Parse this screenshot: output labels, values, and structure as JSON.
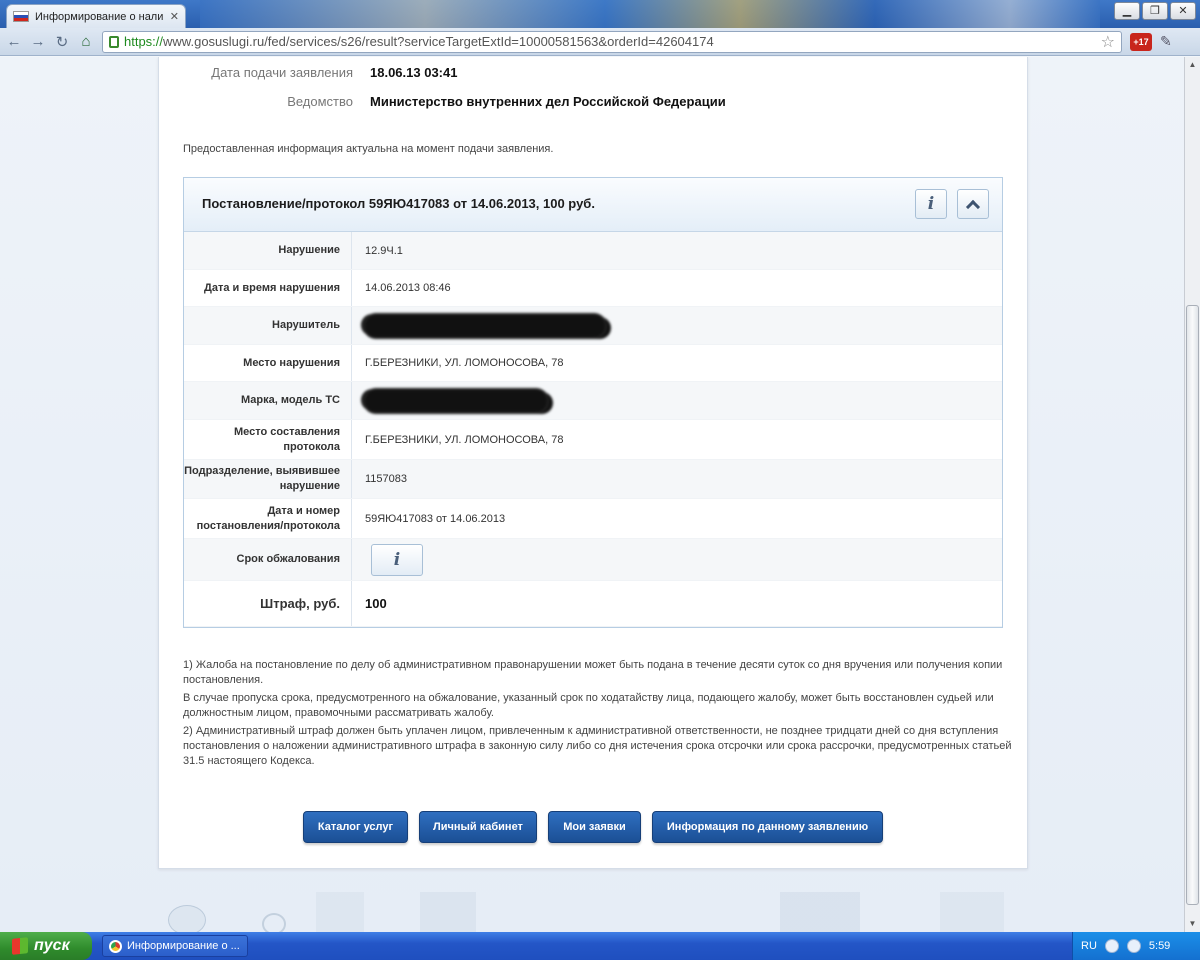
{
  "browser": {
    "tab_title": "Информирование о наличии",
    "tab_close": "✕",
    "url_scheme": "https://",
    "url_rest": "www.gosuslugi.ru/fed/services/s26/result?serviceTargetExtId=10000581563&orderId=42604174",
    "extension_badge": "+17",
    "window_buttons": [
      "▁",
      "❐",
      "✕"
    ]
  },
  "meta": {
    "submission_date_label": "Дата подачи заявления",
    "submission_date_value": "18.06.13 03:41",
    "department_label": "Ведомство",
    "department_value": "Министерство внутренних дел Российской Федерации"
  },
  "notice": "Предоставленная информация актуальна на момент подачи заявления.",
  "panel": {
    "title": "Постановление/протокол 59ЯЮ417083 от 14.06.2013, 100 руб.",
    "rows": {
      "violation_label": "Нарушение",
      "violation_value": "12.9Ч.1",
      "datetime_label": "Дата и время нарушения",
      "datetime_value": "14.06.2013 08:46",
      "offender_label": "Нарушитель",
      "place_label": "Место нарушения",
      "place_value": "Г.БЕРЕЗНИКИ, УЛ. ЛОМОНОСОВА, 78",
      "vehicle_label": "Марка, модель ТС",
      "protocol_place_label": "Место составления протокола",
      "protocol_place_value": "Г.БЕРЕЗНИКИ, УЛ. ЛОМОНОСОВА, 78",
      "division_label": "Подразделение, выявившее нарушение",
      "division_value": "1157083",
      "resolution_label": "Дата и номер постановления/протокола",
      "resolution_value": "59ЯЮ417083 от 14.06.2013",
      "appeal_label": "Срок обжалования",
      "fine_label": "Штраф, руб.",
      "fine_value": "100"
    }
  },
  "footnotes": {
    "p1": "1) Жалоба на постановление по делу об административном правонарушении может быть подана в течение десяти суток со дня вручения или получения копии постановления.",
    "p2": "В случае пропуска срока, предусмотренного на обжалование, указанный срок по ходатайству лица, подающего жалобу, может быть восстановлен судьей или должностным лицом, правомочными рассматривать жалобу.",
    "p3": "2) Административный штраф должен быть уплачен лицом, привлеченным к административной ответственности, не позднее тридцати дней со дня вступления постановления о наложении административного штрафа в законную силу либо со дня истечения срока отсрочки или срока рассрочки, предусмотренных статьей 31.5 настоящего Кодекса."
  },
  "buttons": {
    "catalog": "Каталог услуг",
    "cabinet": "Личный кабинет",
    "my_orders": "Мои заявки",
    "order_info": "Информация по данному заявлению"
  },
  "taskbar": {
    "start_label": "пуск",
    "task_label": "Информирование о ...",
    "lang": "RU",
    "clock": "5:59"
  }
}
